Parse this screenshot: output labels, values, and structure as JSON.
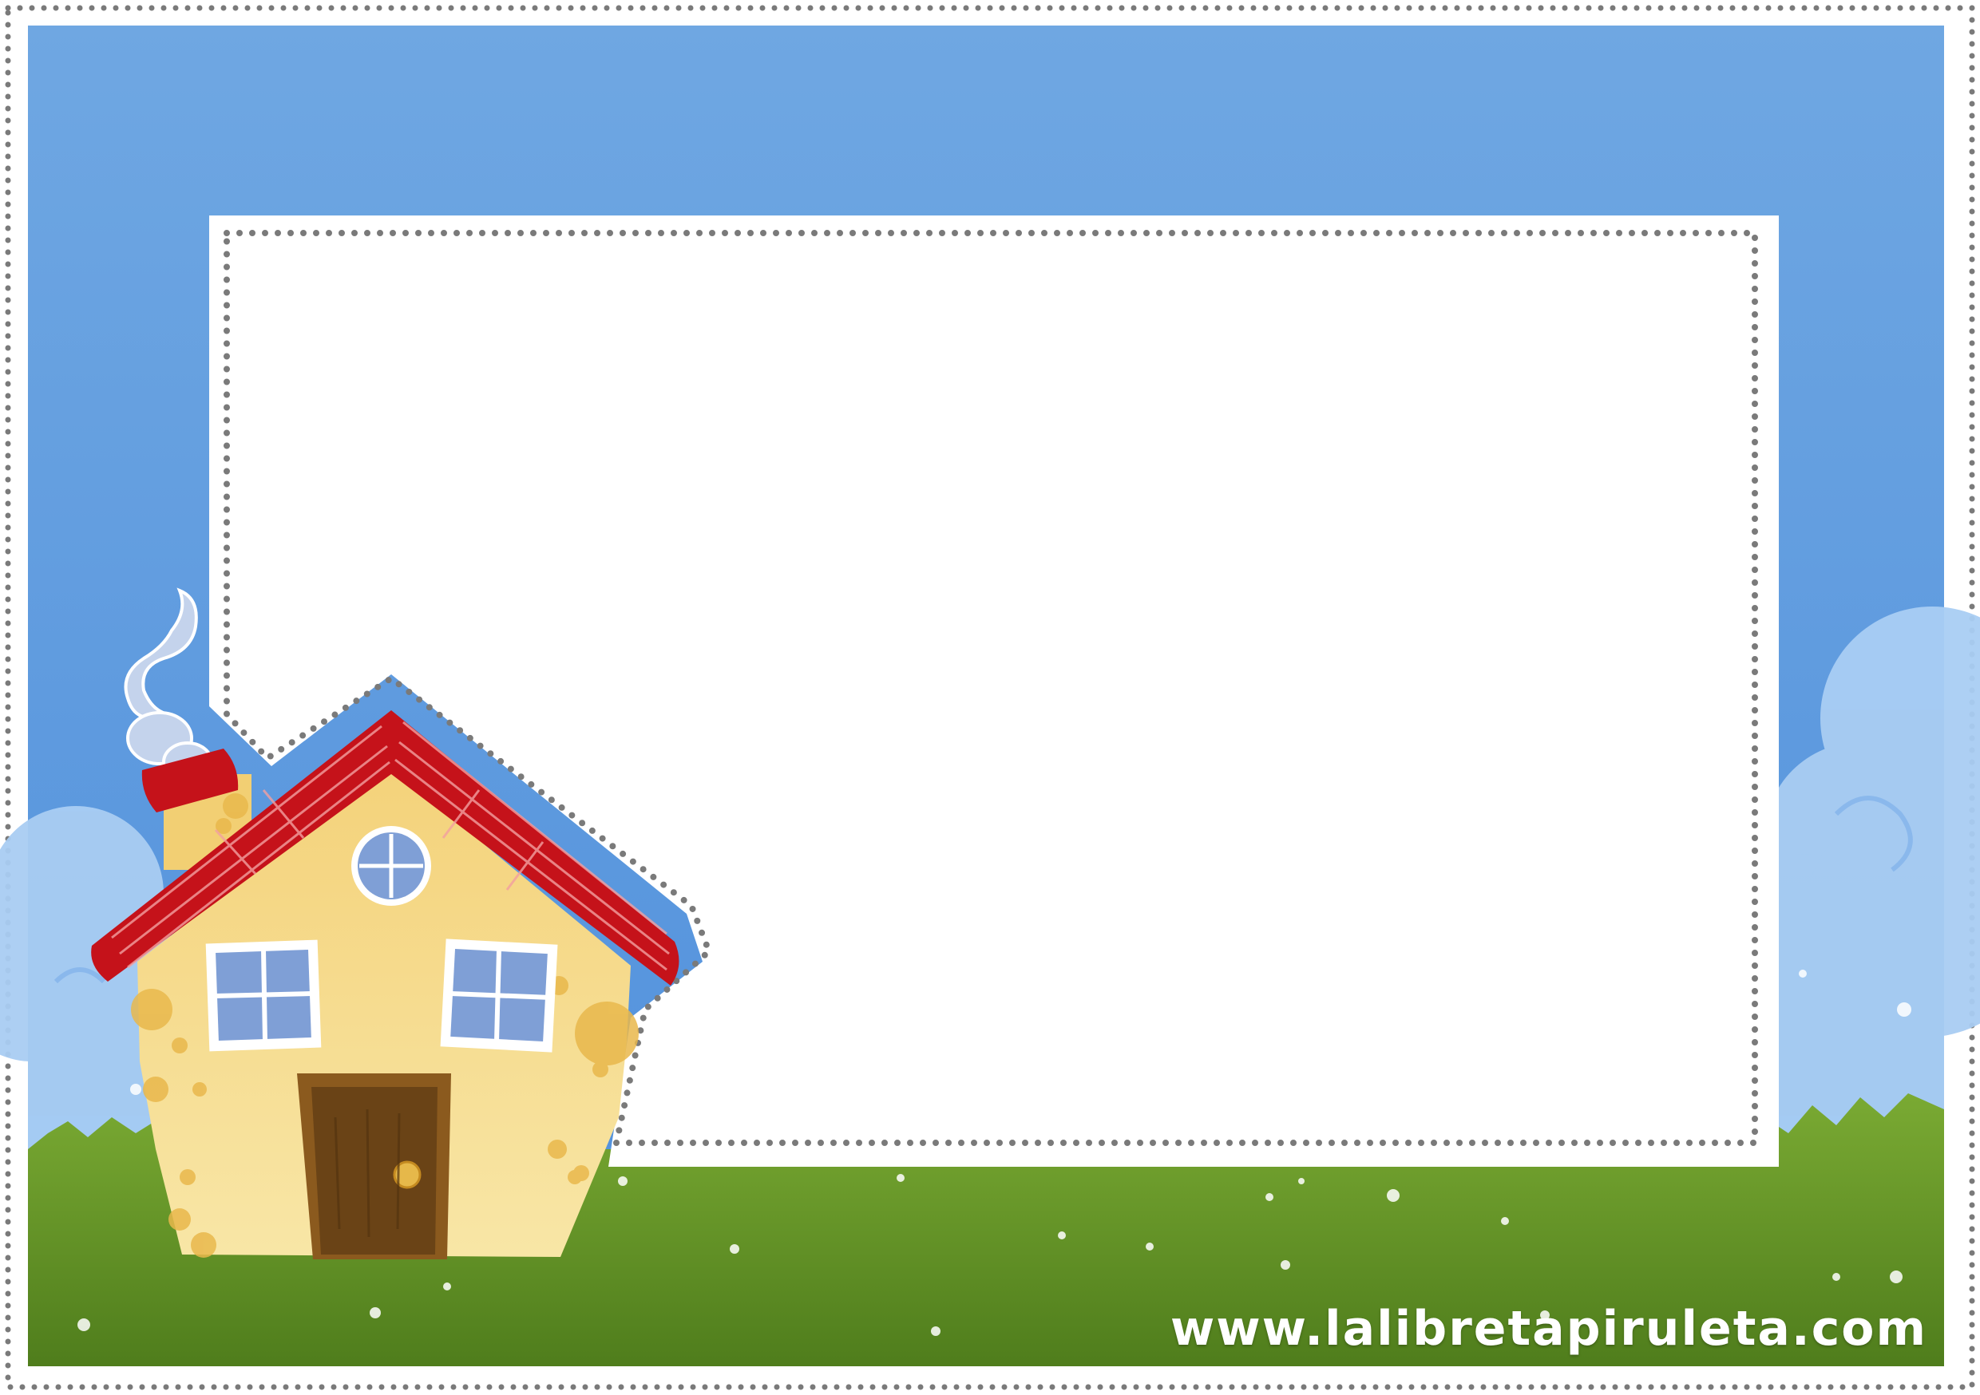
{
  "watermark": {
    "text": "www.lalibretapiruleta.com",
    "color": "#ffffff"
  },
  "colors": {
    "sky_top": "#6ea6e2",
    "sky_bottom": "#5190dc",
    "cloud": "#a9cdf3",
    "grass_dark": "#52801e",
    "grass_light": "#79a832",
    "card": "#ffffff",
    "dots": "#7a7a7a",
    "roof": "#c5121a",
    "roof_stripe": "#f3a0a0",
    "wall": "#f6dc8c",
    "wall_spot": "#e9b84c",
    "door": "#6a4316",
    "window": "#7f9fd6",
    "smoke": "#c4d3ec"
  }
}
